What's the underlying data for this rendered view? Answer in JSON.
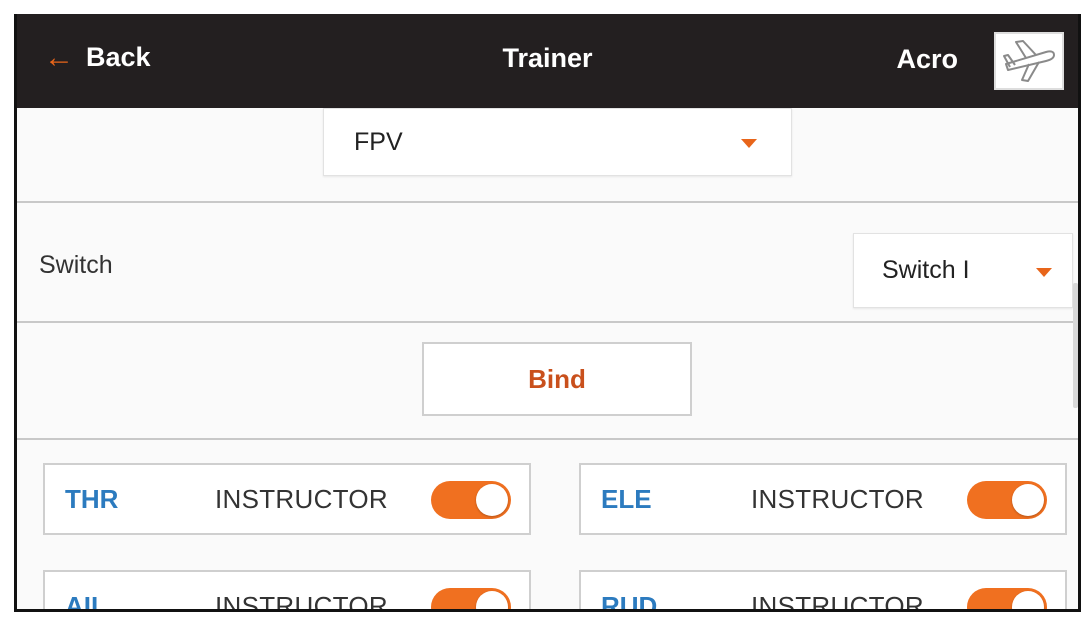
{
  "header": {
    "back_label": "Back",
    "title": "Trainer",
    "model_name": "Acro",
    "model_icon": "airplane-icon"
  },
  "trainer_mode": {
    "value": "FPV"
  },
  "switch_row": {
    "label": "Switch",
    "value": "Switch I"
  },
  "bind_label": "Bind",
  "channels": [
    {
      "name": "THR",
      "mode": "INSTRUCTOR",
      "enabled": true
    },
    {
      "name": "ELE",
      "mode": "INSTRUCTOR",
      "enabled": true
    },
    {
      "name": "AIL",
      "mode": "INSTRUCTOR",
      "enabled": true
    },
    {
      "name": "RUD",
      "mode": "INSTRUCTOR",
      "enabled": true
    }
  ],
  "colors": {
    "accent": "#e8651a",
    "toggle_on": "#f07020",
    "channel_name": "#2c7bbf",
    "header_bg": "#231f20"
  }
}
